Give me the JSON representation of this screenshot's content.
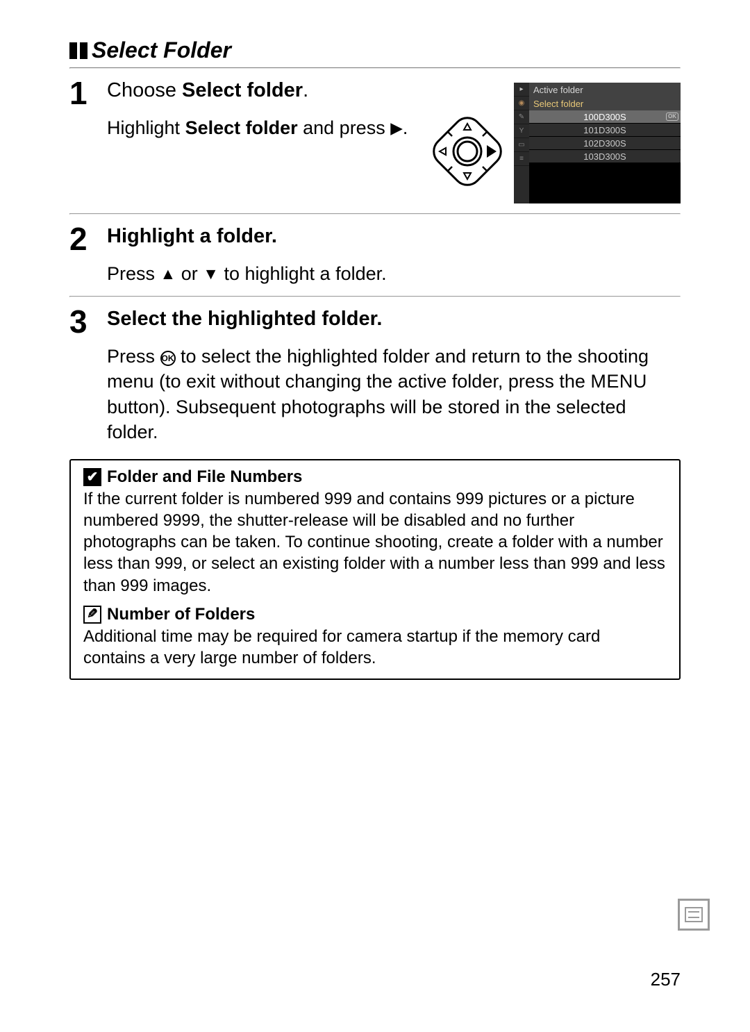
{
  "section_title": "Select Folder",
  "steps": [
    {
      "num": "1",
      "head_prefix": "Choose ",
      "head_bold": "Select folder",
      "head_suffix": ".",
      "body_pre": "Highlight ",
      "body_bold": "Select folder",
      "body_mid": " and press ",
      "body_glyph": "▶",
      "body_post": "."
    },
    {
      "num": "2",
      "head": "Highlight a folder.",
      "body_pre": "Press ",
      "g1": "▲",
      "body_mid1": " or ",
      "g2": "▼",
      "body_post": " to highlight a folder."
    },
    {
      "num": "3",
      "head": "Select the highlighted folder.",
      "body_pre": "Press ",
      "ok_label": "OK",
      "body_mid": " to select the highlighted folder and return to the shooting menu (to exit without changing the active folder, press the ",
      "menu_word": "MENU",
      "body_post": " button).  Subsequent photographs will be stored in the selected folder."
    }
  ],
  "lcd": {
    "title": "Active folder",
    "subtitle": "Select folder",
    "ok": "OK",
    "rows": [
      "100D300S",
      "101D300S",
      "102D300S",
      "103D300S"
    ]
  },
  "notes": [
    {
      "icon": "check",
      "title": "Folder and File Numbers",
      "body": "If the current folder is numbered 999 and contains 999 pictures or a picture numbered 9999, the shutter-release will be disabled and no further photographs can be taken.  To continue shooting, create a folder with a number less than 999, or select an existing folder with a number less than 999 and less than 999 images."
    },
    {
      "icon": "pencil",
      "title": "Number of Folders",
      "body": "Additional time may be required for camera startup if the memory card contains a very large number of folders."
    }
  ],
  "page_number": "257"
}
